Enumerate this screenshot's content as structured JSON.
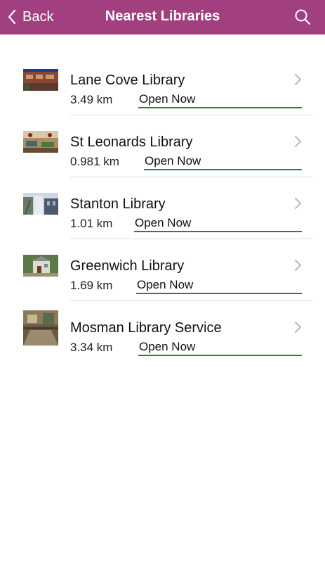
{
  "nav": {
    "back_label": "Back",
    "title": "Nearest Libraries",
    "back_icon": "chevron-left-icon",
    "search_icon": "search-icon",
    "bar_color": "#a2407f"
  },
  "libraries": [
    {
      "name": "Lane Cove Library",
      "distance": "3.49 km",
      "status": "Open Now"
    },
    {
      "name": "St Leonards Library",
      "distance": "0.981 km",
      "status": "Open Now"
    },
    {
      "name": "Stanton Library",
      "distance": "1.01 km",
      "status": "Open Now"
    },
    {
      "name": "Greenwich Library",
      "distance": "1.69 km",
      "status": "Open Now"
    },
    {
      "name": "Mosman Library Service",
      "distance": "3.34 km",
      "status": "Open Now"
    }
  ],
  "status_color": "#1f8a1f"
}
